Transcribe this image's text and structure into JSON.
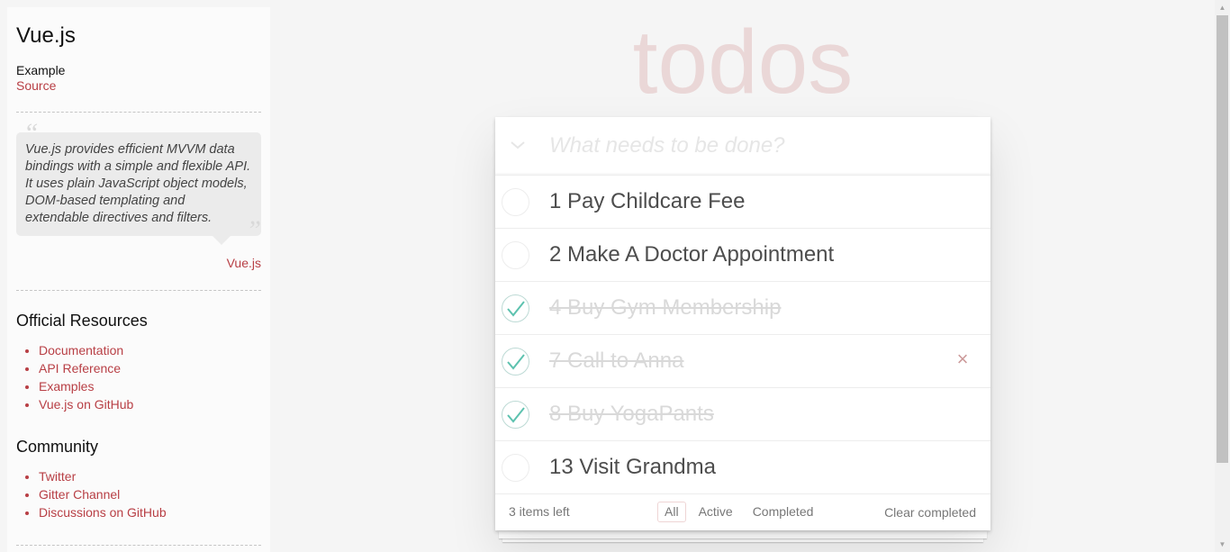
{
  "sidebar": {
    "title": "Vue.js",
    "example_label": "Example",
    "source_link": "Source",
    "quote": "Vue.js provides efficient MVVM data bindings with a simple and flexible API. It uses plain JavaScript object models, DOM-based templating and extendable directives and filters.",
    "quote_open": "“",
    "quote_close": "”",
    "quote_source": "Vue.js",
    "official_resources": {
      "heading": "Official Resources",
      "links": [
        "Documentation",
        "API Reference",
        "Examples",
        "Vue.js on GitHub"
      ]
    },
    "community": {
      "heading": "Community",
      "links": [
        "Twitter",
        "Gitter Channel",
        "Discussions on GitHub"
      ]
    }
  },
  "app": {
    "title": "todos",
    "toggle_all_icon": "chevron-down-icon",
    "new_todo_placeholder": "What needs to be done?",
    "todos": [
      {
        "label": "1 Pay Childcare Fee",
        "completed": false
      },
      {
        "label": "2 Make A Doctor Appointment",
        "completed": false
      },
      {
        "label": "4 Buy Gym Membership",
        "completed": true
      },
      {
        "label": "7 Call to Anna",
        "completed": true
      },
      {
        "label": "8 Buy YogaPants",
        "completed": true
      },
      {
        "label": "13 Visit Grandma",
        "completed": false
      }
    ],
    "destroy_icon": "×",
    "footer": {
      "count": "3 items left",
      "filters": [
        "All",
        "Active",
        "Completed"
      ],
      "selected_filter": "All",
      "clear_completed": "Clear completed"
    }
  },
  "colors": {
    "accent": "#b83f45",
    "check": "#5dc2af",
    "title": "#ead7d7",
    "destroy": "#cc9a9a"
  }
}
